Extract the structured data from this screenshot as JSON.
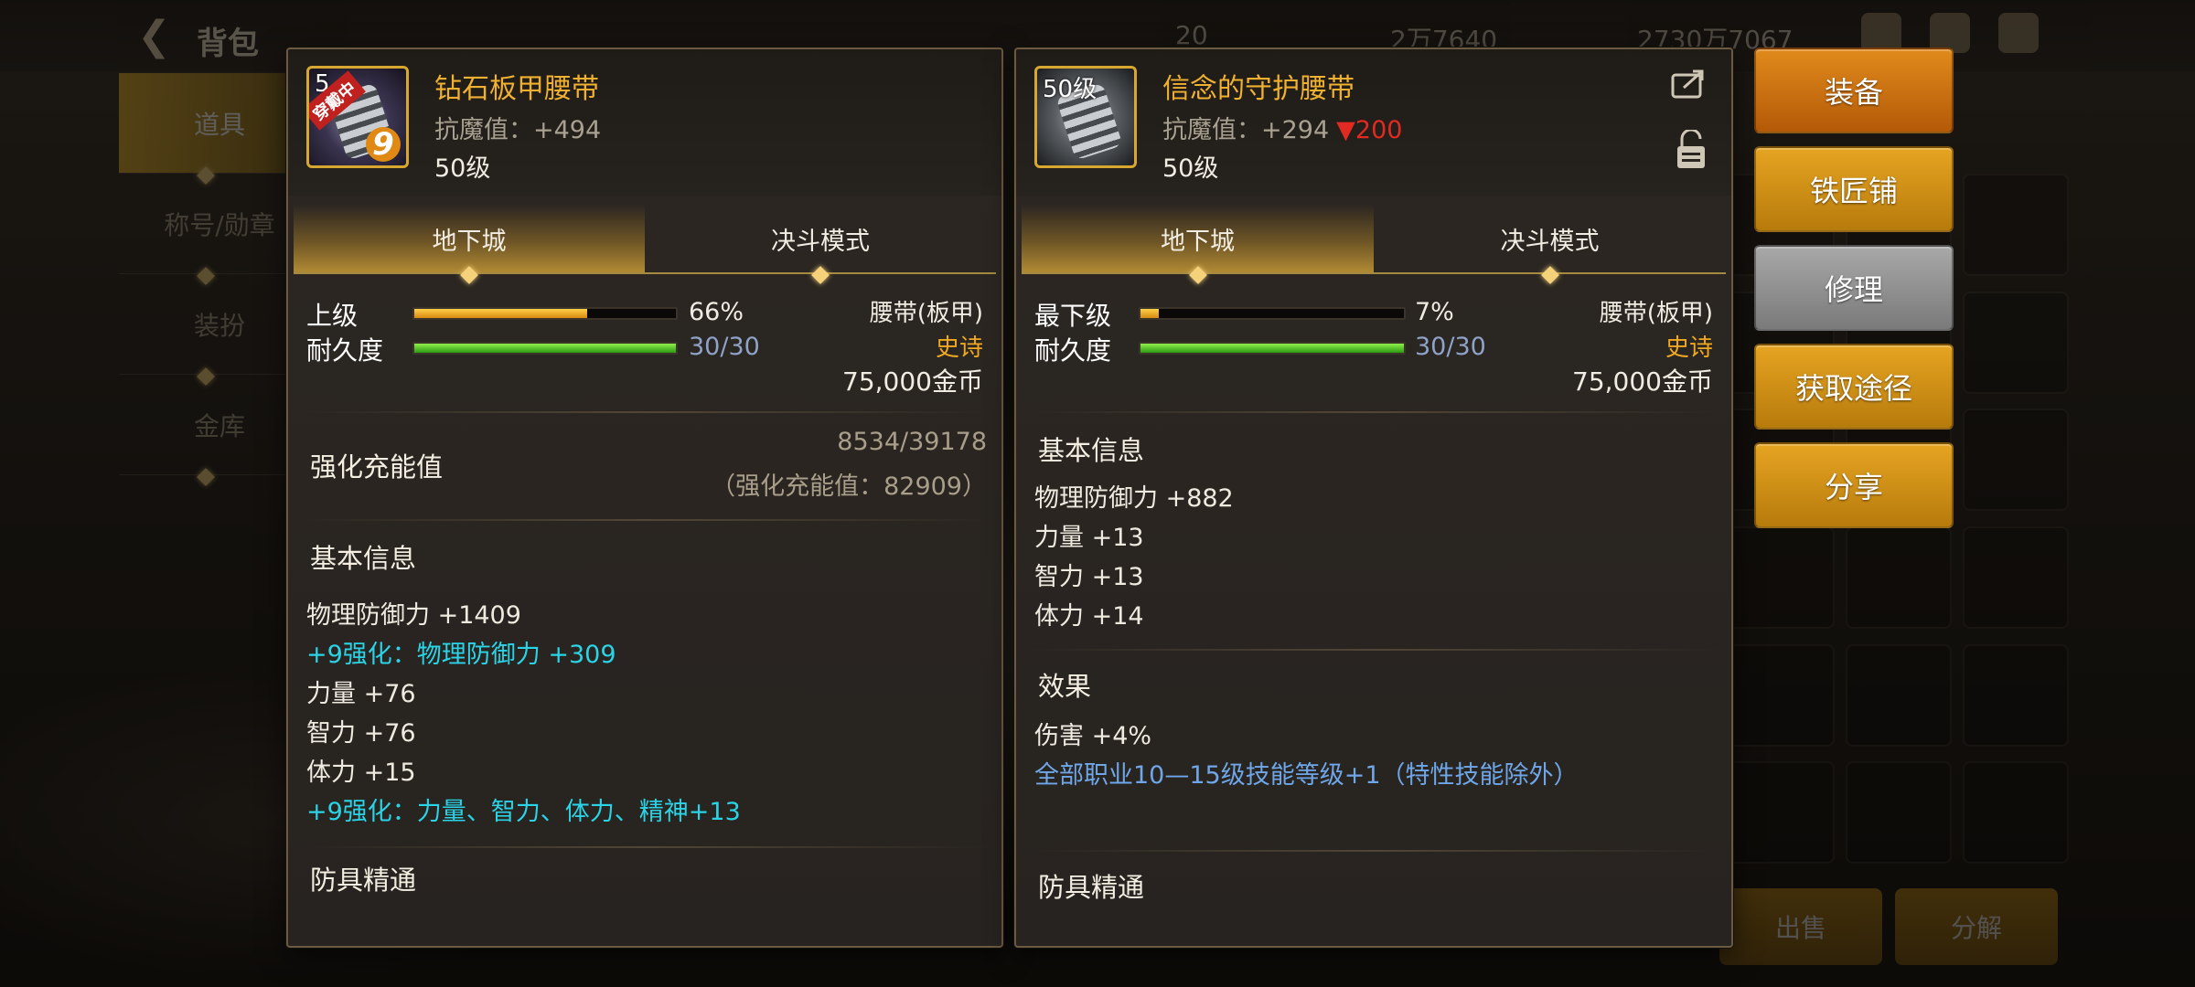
{
  "background": {
    "title": "背包",
    "resources": [
      "20",
      "2万7640",
      "2730万7067"
    ],
    "sidebar_tabs": [
      "道具",
      "称号/勋章",
      "装扮",
      "金库"
    ],
    "bottom_buttons": [
      "出售",
      "分解"
    ]
  },
  "left_item": {
    "level_badge": "5",
    "equipped_tag": "穿戴中",
    "reinforce_level": "9",
    "name": "钻石板甲腰带",
    "stat_label": "抗魔值：",
    "stat_value": "+494",
    "level": "50级",
    "tabs": [
      "地下城",
      "决斗模式"
    ],
    "grade_label": "上级",
    "grade_percent": "66%",
    "grade_fill": 0.66,
    "durability_label": "耐久度",
    "durability_value": "30/30",
    "durability_fill": 1.0,
    "type": "腰带(板甲)",
    "rarity": "史诗",
    "price": "75,000金币",
    "charge_title": "强化充能值",
    "charge_progress": "8534/39178",
    "charge_total": "（强化充能值：82909）",
    "basic_title": "基本信息",
    "basic_lines": [
      {
        "text": "物理防御力 +1409",
        "cls": "line"
      },
      {
        "text": "+9强化：物理防御力 +309",
        "cls": "line cyan"
      },
      {
        "text": "力量 +76",
        "cls": "line"
      },
      {
        "text": "智力 +76",
        "cls": "line"
      },
      {
        "text": "体力 +15",
        "cls": "line"
      },
      {
        "text": "+9强化：力量、智力、体力、精神+13",
        "cls": "line cyan"
      }
    ],
    "mastery_title": "防具精通"
  },
  "right_item": {
    "level_badge": "50级",
    "name": "信念的守护腰带",
    "stat_label": "抗魔值：",
    "stat_value": "+294",
    "stat_diff": "▼200",
    "level": "50级",
    "tabs": [
      "地下城",
      "决斗模式"
    ],
    "grade_label": "最下级",
    "grade_percent": "7%",
    "grade_fill": 0.07,
    "durability_label": "耐久度",
    "durability_value": "30/30",
    "durability_fill": 1.0,
    "type": "腰带(板甲)",
    "rarity": "史诗",
    "price": "75,000金币",
    "basic_title": "基本信息",
    "basic_lines": [
      {
        "text": "物理防御力 +882",
        "cls": "line"
      },
      {
        "text": "力量 +13",
        "cls": "line"
      },
      {
        "text": "智力 +13",
        "cls": "line"
      },
      {
        "text": "体力 +14",
        "cls": "line"
      }
    ],
    "effect_title": "效果",
    "effect_lines": [
      {
        "text": "伤害 +4%",
        "cls": "line"
      },
      {
        "text": "全部职业10—15级技能等级+1（特性技能除外）",
        "cls": "line blue"
      }
    ],
    "mastery_title": "防具精通"
  },
  "actions": [
    "装备",
    "铁匠铺",
    "修理",
    "获取途径",
    "分享"
  ],
  "colors": {
    "gold_text": "#f0b030",
    "enhance_cyan": "#2ad4e6",
    "diff_red": "#e02a22",
    "effect_blue": "#6fa6e8"
  }
}
